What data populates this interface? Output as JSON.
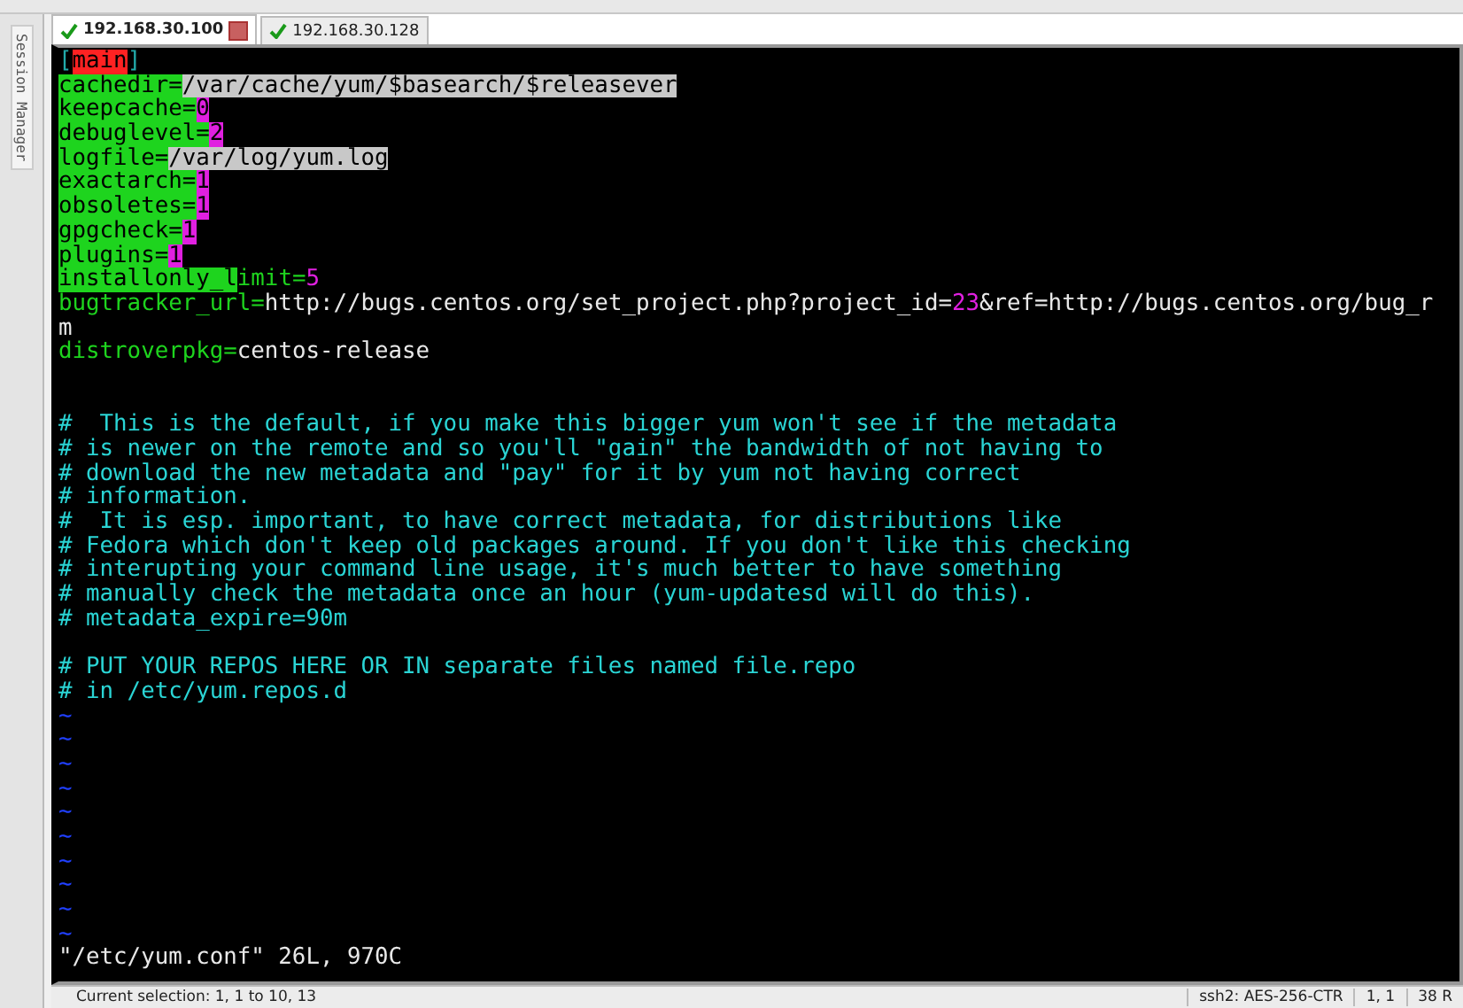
{
  "side_panel": {
    "title": "Session Manager"
  },
  "tabs": [
    {
      "label": "192.168.30.100",
      "selected": true,
      "connected": true
    },
    {
      "label": "192.168.30.128",
      "selected": false,
      "connected": true
    }
  ],
  "terminal": {
    "lines": [
      [
        {
          "kind": "bracket",
          "text": "["
        },
        {
          "kind": "section",
          "text": "main"
        },
        {
          "kind": "bracket",
          "text": "]"
        }
      ],
      [
        {
          "kind": "key",
          "text": "cachedir="
        },
        {
          "kind": "path",
          "text": "/var/cache/yum/$basearch/$releasever"
        }
      ],
      [
        {
          "kind": "key",
          "text": "keepcache="
        },
        {
          "kind": "num",
          "text": "0"
        }
      ],
      [
        {
          "kind": "key",
          "text": "debuglevel="
        },
        {
          "kind": "num",
          "text": "2"
        }
      ],
      [
        {
          "kind": "key",
          "text": "logfile="
        },
        {
          "kind": "path",
          "text": "/var/log/yum.log"
        }
      ],
      [
        {
          "kind": "key",
          "text": "exactarch="
        },
        {
          "kind": "num",
          "text": "1"
        }
      ],
      [
        {
          "kind": "key",
          "text": "obsoletes="
        },
        {
          "kind": "num",
          "text": "1"
        }
      ],
      [
        {
          "kind": "key",
          "text": "gpgcheck="
        },
        {
          "kind": "num",
          "text": "1"
        }
      ],
      [
        {
          "kind": "key",
          "text": "plugins="
        },
        {
          "kind": "num",
          "text": "1"
        }
      ],
      [
        {
          "kind": "key",
          "text": "installonly_l"
        },
        {
          "kind": "keytext",
          "text": "imit="
        },
        {
          "kind": "numtext",
          "text": "5"
        }
      ],
      [
        {
          "kind": "keytext",
          "text": "bugtracker_url="
        },
        {
          "kind": "plain",
          "text": "http://bugs.centos.org/set_project.php?project_id="
        },
        {
          "kind": "numtext",
          "text": "23"
        },
        {
          "kind": "plain",
          "text": "&ref=http://bugs.centos.org/bug_r"
        }
      ],
      [
        {
          "kind": "plain",
          "text": "m"
        }
      ],
      [
        {
          "kind": "keytext",
          "text": "distroverpkg="
        },
        {
          "kind": "plain",
          "text": "centos-release"
        }
      ],
      {
        "kind": "blank"
      },
      {
        "kind": "blank"
      },
      [
        {
          "kind": "comment",
          "text": "#  This is the default, if you make this bigger yum won't see if the metadata"
        }
      ],
      [
        {
          "kind": "comment",
          "text": "# is newer on the remote and so you'll \"gain\" the bandwidth of not having to"
        }
      ],
      [
        {
          "kind": "comment",
          "text": "# download the new metadata and \"pay\" for it by yum not having correct"
        }
      ],
      [
        {
          "kind": "comment",
          "text": "# information."
        }
      ],
      [
        {
          "kind": "comment",
          "text": "#  It is esp. important, to have correct metadata, for distributions like"
        }
      ],
      [
        {
          "kind": "comment",
          "text": "# Fedora which don't keep old packages around. If you don't like this checking"
        }
      ],
      [
        {
          "kind": "comment",
          "text": "# interupting your command line usage, it's much better to have something"
        }
      ],
      [
        {
          "kind": "comment",
          "text": "# manually check the metadata once an hour (yum-updatesd will do this)."
        }
      ],
      [
        {
          "kind": "comment",
          "text": "# metadata_expire=90m"
        }
      ],
      {
        "kind": "blank"
      },
      [
        {
          "kind": "comment",
          "text": "# PUT YOUR REPOS HERE OR IN separate files named file.repo"
        }
      ],
      [
        {
          "kind": "comment",
          "text": "# in /etc/yum.repos.d"
        }
      ],
      [
        {
          "kind": "tilde",
          "text": "~"
        }
      ],
      [
        {
          "kind": "tilde",
          "text": "~"
        }
      ],
      [
        {
          "kind": "tilde",
          "text": "~"
        }
      ],
      [
        {
          "kind": "tilde",
          "text": "~"
        }
      ],
      [
        {
          "kind": "tilde",
          "text": "~"
        }
      ],
      [
        {
          "kind": "tilde",
          "text": "~"
        }
      ],
      [
        {
          "kind": "tilde",
          "text": "~"
        }
      ],
      [
        {
          "kind": "tilde",
          "text": "~"
        }
      ],
      [
        {
          "kind": "tilde",
          "text": "~"
        }
      ],
      [
        {
          "kind": "tilde",
          "text": "~"
        }
      ],
      [
        {
          "kind": "plain",
          "text": "\"/etc/yum.conf\" 26L, 970C"
        }
      ]
    ]
  },
  "status_bar": {
    "selection": "Current selection: 1, 1 to 10, 13",
    "cipher": "ssh2: AES-256-CTR",
    "position": "1, 1",
    "size": "38 R"
  }
}
